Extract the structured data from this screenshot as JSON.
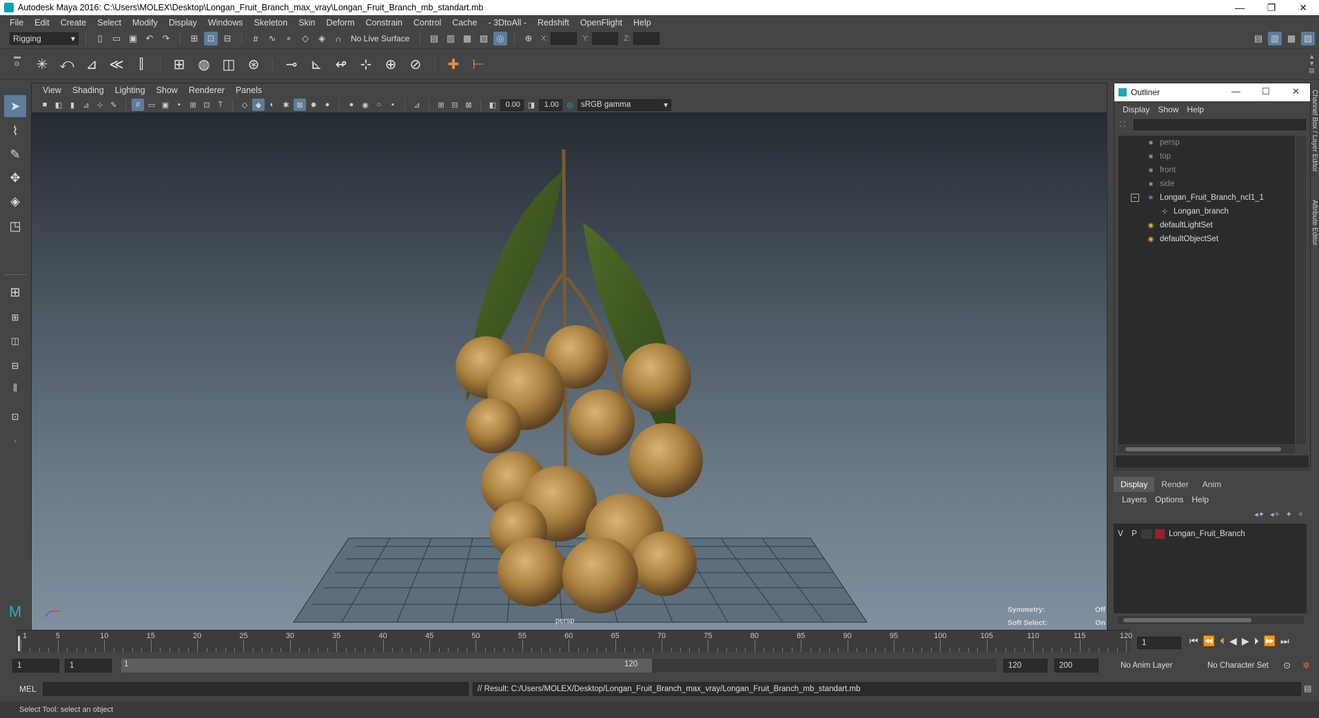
{
  "window": {
    "title": "Autodesk Maya 2016: C:\\Users\\MOLEX\\Desktop\\Longan_Fruit_Branch_max_vray\\Longan_Fruit_Branch_mb_standart.mb",
    "minimize": "—",
    "maximize": "❐",
    "close": "✕"
  },
  "menubar": [
    "File",
    "Edit",
    "Create",
    "Select",
    "Modify",
    "Display",
    "Windows",
    "Skeleton",
    "Skin",
    "Deform",
    "Constrain",
    "Control",
    "Cache",
    "- 3DtoAll -",
    "Redshift",
    "OpenFlight",
    "Help"
  ],
  "statusline": {
    "menu_set": "Rigging",
    "live_surface": "No Live Surface",
    "x_label": "X:",
    "y_label": "Y:",
    "z_label": "Z:"
  },
  "viewport": {
    "menu": [
      "View",
      "Shading",
      "Lighting",
      "Show",
      "Renderer",
      "Panels"
    ],
    "exposure": "0.00",
    "gamma_value": "1.00",
    "color_space": "sRGB gamma",
    "camera_label": "persp",
    "symmetry_label": "Symmetry:",
    "symmetry_value": "Off",
    "soft_select_label": "Soft Select:",
    "soft_select_value": "On"
  },
  "outliner": {
    "title": "Outliner",
    "menu": [
      "Display",
      "Show",
      "Help"
    ],
    "items": [
      {
        "label": "persp",
        "icon": "camera-icon",
        "dim": true
      },
      {
        "label": "top",
        "icon": "camera-icon",
        "dim": true
      },
      {
        "label": "front",
        "icon": "camera-icon",
        "dim": true
      },
      {
        "label": "side",
        "icon": "camera-icon",
        "dim": true
      },
      {
        "label": "Longan_Fruit_Branch_ncl1_1",
        "icon": "group-icon",
        "dim": false
      },
      {
        "label": "Longan_branch",
        "icon": "mesh-icon",
        "dim": false
      },
      {
        "label": "defaultLightSet",
        "icon": "set-icon",
        "dim": false
      },
      {
        "label": "defaultObjectSet",
        "icon": "set-icon",
        "dim": false
      }
    ]
  },
  "side_tabs": [
    "Channel Box / Layer Editor",
    "Attribute Editor"
  ],
  "layer_editor": {
    "tabs": [
      "Display",
      "Render",
      "Anim"
    ],
    "menu": [
      "Layers",
      "Options",
      "Help"
    ],
    "layer": {
      "v": "V",
      "p": "P",
      "name": "Longan_Fruit_Branch",
      "color": "#9a1e30"
    }
  },
  "timeline": {
    "ticks": [
      "1",
      "5",
      "10",
      "15",
      "20",
      "25",
      "30",
      "35",
      "40",
      "45",
      "50",
      "55",
      "60",
      "65",
      "70",
      "75",
      "80",
      "85",
      "90",
      "95",
      "100",
      "105",
      "110",
      "115",
      "120"
    ],
    "current_frame": "1"
  },
  "range": {
    "start": "1",
    "playback_start": "1",
    "range_start_label": "1",
    "range_end_label": "120",
    "playback_end": "120",
    "end": "200",
    "anim_layer": "No Anim Layer",
    "character_set": "No Character Set"
  },
  "command": {
    "language": "MEL",
    "result": "// Result: C:/Users/MOLEX/Desktop/Longan_Fruit_Branch_max_vray/Longan_Fruit_Branch_mb_standart.mb"
  },
  "help_line": "Select Tool: select an object"
}
